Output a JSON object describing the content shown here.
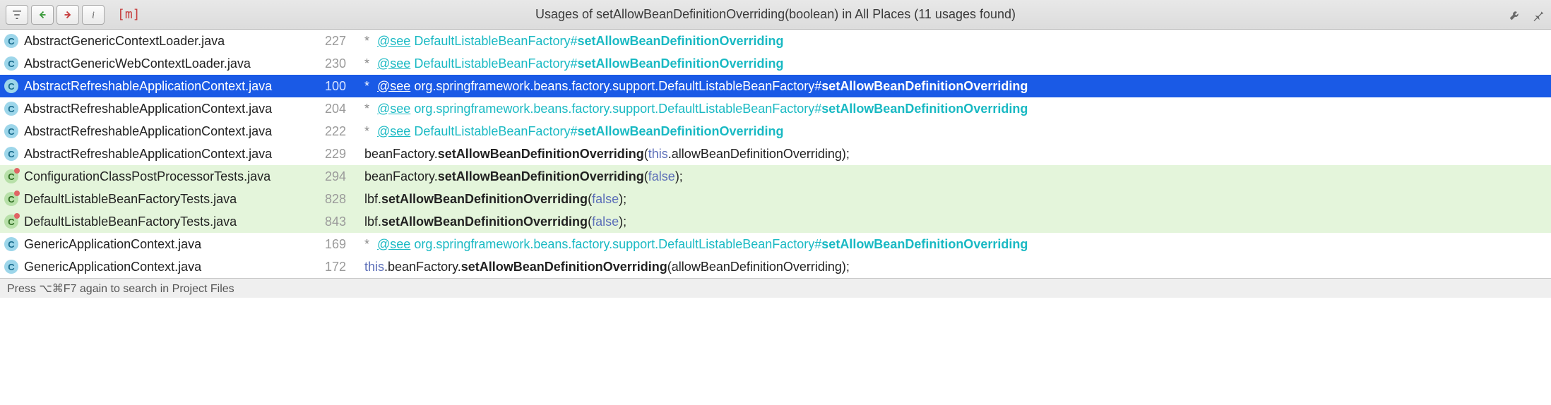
{
  "header": {
    "title": "Usages of setAllowBeanDefinitionOverriding(boolean) in All Places (11 usages found)",
    "m_label": "[m]"
  },
  "icon_letters": {
    "c": "C"
  },
  "rows": [
    {
      "icon": "c",
      "file": "AbstractGenericContextLoader.java",
      "line": "227",
      "selected": false,
      "green": false,
      "kind": "see_short",
      "prefix": "* ",
      "tag": "@see",
      "space": " ",
      "cls": "DefaultListableBeanFactory#",
      "method": "setAllowBeanDefinitionOverriding"
    },
    {
      "icon": "c",
      "file": "AbstractGenericWebContextLoader.java",
      "line": "230",
      "selected": false,
      "green": false,
      "kind": "see_short",
      "prefix": "* ",
      "tag": "@see",
      "space": " ",
      "cls": "DefaultListableBeanFactory#",
      "method": "setAllowBeanDefinitionOverriding"
    },
    {
      "icon": "c",
      "file": "AbstractRefreshableApplicationContext.java",
      "line": "100",
      "selected": true,
      "green": false,
      "kind": "see_long",
      "prefix": "* ",
      "tag": "@see",
      "space": " ",
      "cls": "org.springframework.beans.factory.support.DefaultListableBeanFactory#",
      "method": "setAllowBeanDefinitionOverriding"
    },
    {
      "icon": "c",
      "file": "AbstractRefreshableApplicationContext.java",
      "line": "204",
      "selected": false,
      "green": false,
      "kind": "see_long",
      "prefix": "* ",
      "tag": "@see",
      "space": " ",
      "cls": "org.springframework.beans.factory.support.DefaultListableBeanFactory#",
      "method": "setAllowBeanDefinitionOverriding"
    },
    {
      "icon": "c",
      "file": "AbstractRefreshableApplicationContext.java",
      "line": "222",
      "selected": false,
      "green": false,
      "kind": "see_short",
      "prefix": "* ",
      "tag": "@see",
      "space": " ",
      "cls": "DefaultListableBeanFactory#",
      "method": "setAllowBeanDefinitionOverriding"
    },
    {
      "icon": "c",
      "file": "AbstractRefreshableApplicationContext.java",
      "line": "229",
      "selected": false,
      "green": false,
      "kind": "code_this",
      "pre": "beanFactory.",
      "method": "setAllowBeanDefinitionOverriding",
      "open": "(",
      "kw": "this",
      "post": ".allowBeanDefinitionOverriding);"
    },
    {
      "icon": "cg",
      "file": "ConfigurationClassPostProcessorTests.java",
      "line": "294",
      "selected": false,
      "green": true,
      "kind": "code_false",
      "pre": "beanFactory.",
      "method": "setAllowBeanDefinitionOverriding",
      "open": "(",
      "kw": "false",
      "post": ");"
    },
    {
      "icon": "cg",
      "file": "DefaultListableBeanFactoryTests.java",
      "line": "828",
      "selected": false,
      "green": true,
      "kind": "code_false",
      "pre": "lbf.",
      "method": "setAllowBeanDefinitionOverriding",
      "open": "(",
      "kw": "false",
      "post": ");"
    },
    {
      "icon": "cg",
      "file": "DefaultListableBeanFactoryTests.java",
      "line": "843",
      "selected": false,
      "green": true,
      "kind": "code_false",
      "pre": "lbf.",
      "method": "setAllowBeanDefinitionOverriding",
      "open": "(",
      "kw": "false",
      "post": ");"
    },
    {
      "icon": "c",
      "file": "GenericApplicationContext.java",
      "line": "169",
      "selected": false,
      "green": false,
      "kind": "see_long",
      "prefix": "* ",
      "tag": "@see",
      "space": " ",
      "cls": "org.springframework.beans.factory.support.DefaultListableBeanFactory#",
      "method": "setAllowBeanDefinitionOverriding"
    },
    {
      "icon": "c",
      "file": "GenericApplicationContext.java",
      "line": "172",
      "selected": false,
      "green": false,
      "kind": "code_this",
      "pre": "",
      "kw": "this",
      "mid": ".beanFactory.",
      "method": "setAllowBeanDefinitionOverriding",
      "open": "(",
      "post": "allowBeanDefinitionOverriding);"
    }
  ],
  "footer": {
    "hint": "Press ⌥⌘F7 again to search in Project Files"
  }
}
